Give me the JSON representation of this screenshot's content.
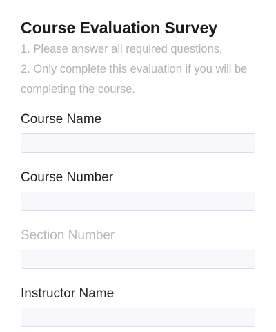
{
  "form": {
    "title": "Course Evaluation Survey",
    "instructions": [
      "1. Please answer all required questions.",
      "2. Only complete this evaluation if you will be completing the course."
    ],
    "fields": [
      {
        "label": "Course Name",
        "value": "",
        "placeholder": ""
      },
      {
        "label": "Course Number",
        "value": "",
        "placeholder": ""
      },
      {
        "label": "Section Number",
        "value": "",
        "placeholder": ""
      },
      {
        "label": "Instructor Name",
        "value": "",
        "placeholder": ""
      }
    ]
  }
}
